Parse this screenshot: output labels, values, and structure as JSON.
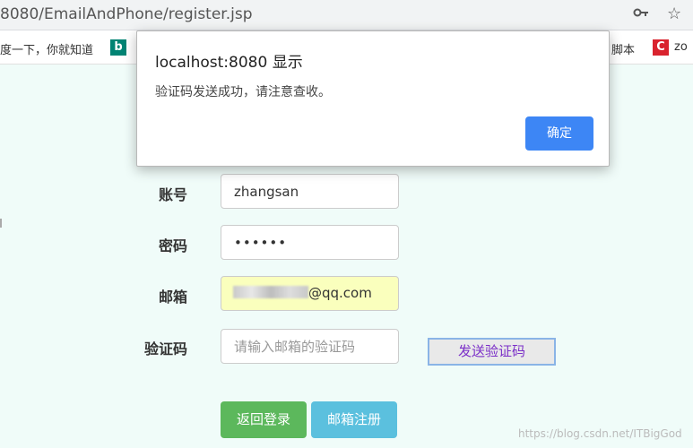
{
  "browser": {
    "address": "8080/EmailAndPhone/register.jsp",
    "key_icon": "key-icon",
    "star_icon": "star-icon"
  },
  "bookmarks": {
    "baidu_label": "度一下，你就知道",
    "bing_icon": "bing-icon",
    "jiaoben_label": "脚本",
    "csdn_icon": "csdn-c-icon",
    "csdn_label": "zo"
  },
  "form": {
    "account_label": "账号",
    "account_value": "zhangsan",
    "password_label": "密码",
    "password_value": "••••••",
    "email_label": "邮箱",
    "email_suffix": "@qq.com",
    "code_label": "验证码",
    "code_placeholder": "请输入邮箱的验证码",
    "send_code_button": "发送验证码",
    "back_login_button": "返回登录",
    "register_button": "邮箱注册"
  },
  "dialog": {
    "title": "localhost:8080 显示",
    "message": "验证码发送成功，请注意查收。",
    "ok_button": "确定"
  },
  "watermark": "https://blog.csdn.net/ITBigGod",
  "colors": {
    "page_bg": "#f0fcf9",
    "email_autofill": "#faffbd",
    "green_button": "#5cb85c",
    "blue_button": "#5bc0de",
    "dialog_ok": "#3d86f5",
    "send_code_text": "#7b2fc8"
  }
}
